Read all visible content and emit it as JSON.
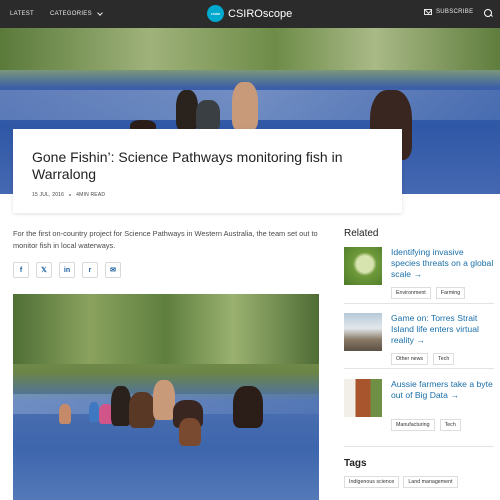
{
  "header": {
    "latest": "LATEST",
    "categories": "CATEGORIES",
    "logo_text": "CSIRO",
    "brand": "CSIROscope",
    "subscribe": "SUBSCRIBE"
  },
  "article": {
    "title": "Gone Fishin’: Science Pathways monitoring fish in Warralong",
    "date": "15 JUL, 2016",
    "read_time": "4MIN READ",
    "intro": "For the first on-country project for Science Pathways in Western Australia, the team set out to monitor fish in local waterways."
  },
  "share": [
    "f",
    "𝕏",
    "in",
    "r",
    "✉"
  ],
  "sidebar": {
    "related_heading": "Related",
    "related": [
      {
        "title": "Identifying invasive species threats on a global scale →",
        "tags": [
          "Environment",
          "Farming"
        ]
      },
      {
        "title": "Game on: Torres Strait Island life enters virtual reality →",
        "tags": [
          "Other news",
          "Tech"
        ]
      },
      {
        "title": "Aussie farmers take a byte out of Big Data →",
        "tags": [
          "Manufacturing",
          "Tech"
        ]
      }
    ],
    "tags_heading": "Tags",
    "tags": [
      "Indigenous science",
      "Land management"
    ]
  },
  "icons": {
    "search": "search-icon",
    "mail": "mail-icon",
    "chevron": "chevron-down-icon",
    "facebook": "facebook-icon",
    "x": "x-icon",
    "linkedin": "linkedin-icon",
    "reddit": "reddit-icon",
    "email": "email-icon"
  },
  "colors": {
    "topbar": "#2b2b2b",
    "link": "#1a6fa8",
    "logo": "#00a9ce"
  }
}
